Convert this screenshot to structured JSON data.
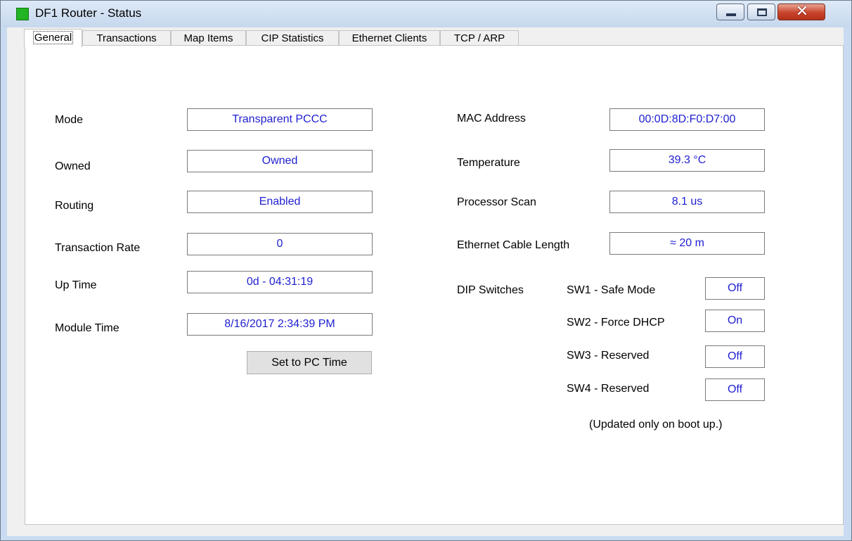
{
  "window": {
    "title": "DF1 Router - Status",
    "close_glyph": "✕"
  },
  "tabs": [
    "General",
    "Transactions",
    "Map Items",
    "CIP Statistics",
    "Ethernet Clients",
    "TCP / ARP"
  ],
  "left": {
    "mode_label": "Mode",
    "mode_value": "Transparent PCCC",
    "owned_label": "Owned",
    "owned_value": "Owned",
    "routing_label": "Routing",
    "routing_value": "Enabled",
    "rate_label": "Transaction Rate",
    "rate_value": "0",
    "uptime_label": "Up Time",
    "uptime_value": "0d - 04:31:19",
    "moduletime_label": "Module Time",
    "moduletime_value": "8/16/2017 2:34:39 PM",
    "set_time_button": "Set to PC Time"
  },
  "right": {
    "mac_label": "MAC Address",
    "mac_value": "00:0D:8D:F0:D7:00",
    "temp_label": "Temperature",
    "temp_value": "39.3 °C",
    "scan_label": "Processor Scan",
    "scan_value": "8.1 us",
    "cable_label": "Ethernet Cable Length",
    "cable_value": "≈ 20 m",
    "dip_label": "DIP Switches",
    "sw1_label": "SW1 - Safe Mode",
    "sw1_value": "Off",
    "sw2_label": "SW2 - Force DHCP",
    "sw2_value": "On",
    "sw3_label": "SW3 - Reserved",
    "sw3_value": "Off",
    "sw4_label": "SW4 - Reserved",
    "sw4_value": "Off",
    "note": "(Updated only on boot up.)"
  },
  "colors": {
    "value_text": "#1f1fd0",
    "status_icon": "#22b422",
    "close_button": "#c9432b"
  }
}
